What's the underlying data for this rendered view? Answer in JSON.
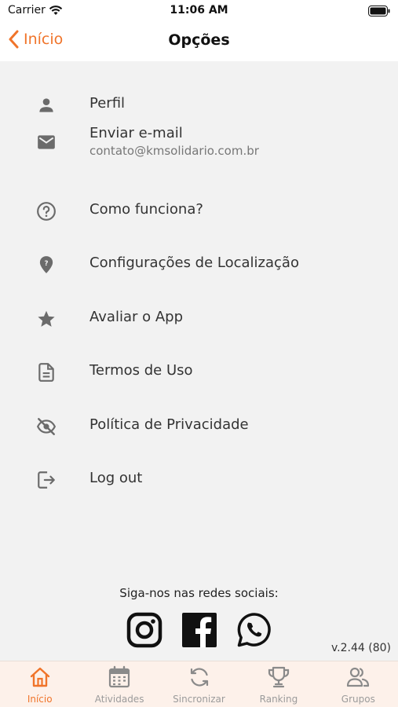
{
  "status_bar": {
    "carrier": "Carrier",
    "time": "11:06 AM"
  },
  "nav": {
    "back_label": "Início",
    "title": "Opções"
  },
  "menu": {
    "items": [
      {
        "label": "Perfil",
        "icon": "person-icon"
      },
      {
        "label": "Enviar e-mail",
        "sub": "contato@kmsolidario.com.br",
        "icon": "mail-icon"
      },
      {
        "label": "Como funciona?",
        "icon": "help-circle-icon"
      },
      {
        "label": "Configurações de Localização",
        "icon": "location-pin-icon"
      },
      {
        "label": "Avaliar o App",
        "icon": "star-icon"
      },
      {
        "label": "Termos de Uso",
        "icon": "document-icon"
      },
      {
        "label": "Política de Privacidade",
        "icon": "eye-off-icon"
      },
      {
        "label": "Log out",
        "icon": "logout-icon"
      }
    ]
  },
  "social": {
    "title": "Siga-nos nas redes sociais:",
    "icons": [
      "instagram-icon",
      "facebook-icon",
      "whatsapp-icon"
    ]
  },
  "version": "v.2.44 (80)",
  "tab_bar": {
    "tabs": [
      {
        "label": "Início",
        "icon": "home-icon",
        "active": true
      },
      {
        "label": "Atividades",
        "icon": "calendar-icon",
        "active": false
      },
      {
        "label": "Sincronizar",
        "icon": "sync-icon",
        "active": false
      },
      {
        "label": "Ranking",
        "icon": "trophy-icon",
        "active": false
      },
      {
        "label": "Grupos",
        "icon": "group-icon",
        "active": false
      }
    ]
  },
  "colors": {
    "accent": "#f0742a",
    "icon_gray": "#6b6b6b",
    "tab_inactive": "#9b9b9b",
    "background": "#f2f2f2"
  }
}
